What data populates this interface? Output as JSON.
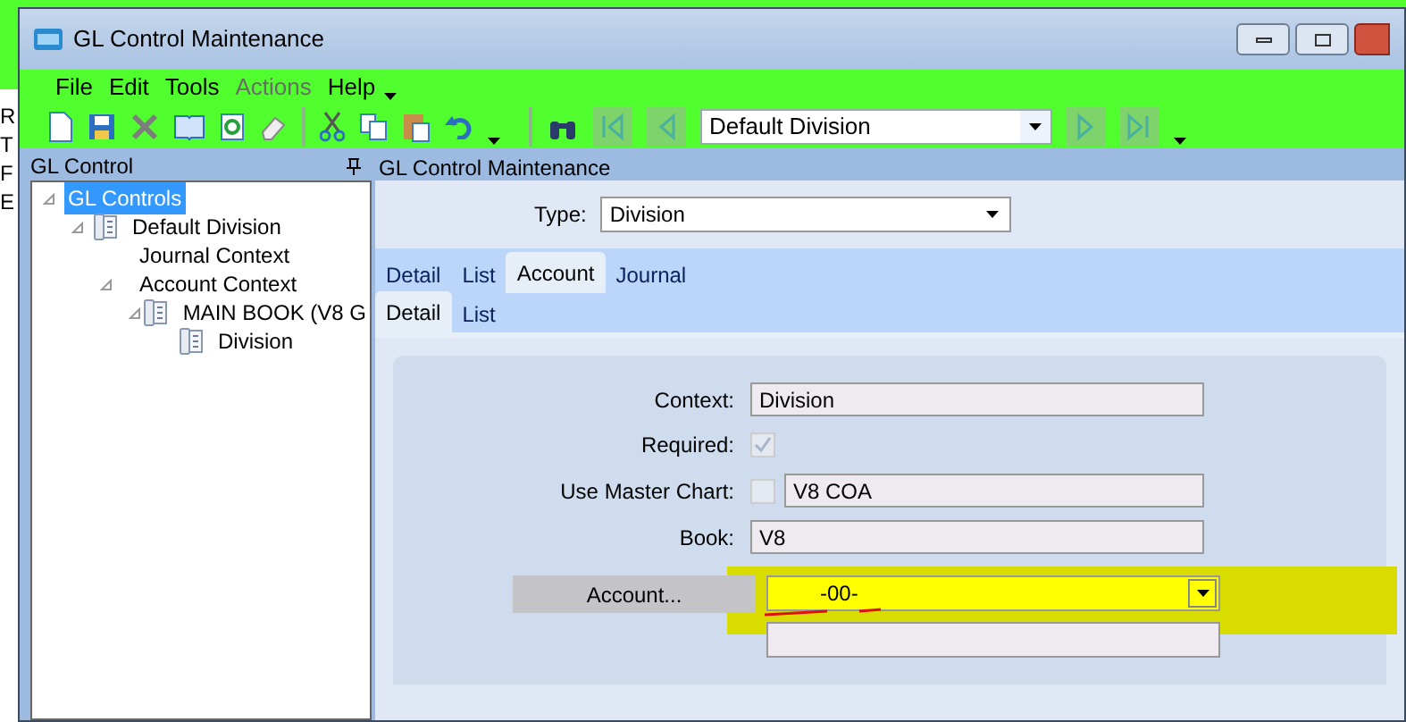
{
  "window": {
    "title": "GL Control Maintenance"
  },
  "background_fragments": [
    "R",
    "T",
    "F",
    "E"
  ],
  "menu": [
    {
      "label": "File",
      "disabled": false
    },
    {
      "label": "Edit",
      "disabled": false
    },
    {
      "label": "Tools",
      "disabled": false
    },
    {
      "label": "Actions",
      "disabled": true
    },
    {
      "label": "Help",
      "disabled": false
    }
  ],
  "toolbar": {
    "division_select": {
      "value": "Default Division"
    }
  },
  "tree_panel": {
    "title": "GL Control",
    "items": [
      {
        "label": "GL Controls",
        "selected": true,
        "expanded": true,
        "icon": false,
        "children": [
          {
            "label": "Default Division",
            "selected": false,
            "expanded": true,
            "icon": true,
            "children": [
              {
                "label": "Journal Context",
                "selected": false,
                "icon": false
              },
              {
                "label": "Account Context",
                "selected": false,
                "expanded": true,
                "icon": false,
                "children": [
                  {
                    "label": "MAIN BOOK (V8 G",
                    "selected": false,
                    "expanded": true,
                    "icon": true,
                    "children": [
                      {
                        "label": "Division",
                        "selected": false,
                        "icon": true
                      }
                    ]
                  }
                ]
              }
            ]
          }
        ]
      }
    ]
  },
  "main_panel": {
    "title": "GL Control Maintenance",
    "type_label": "Type:",
    "type_value": "Division",
    "tabs": [
      {
        "label": "Detail",
        "selected": false
      },
      {
        "label": "List",
        "selected": false
      },
      {
        "label": "Account",
        "selected": true
      },
      {
        "label": "Journal",
        "selected": false
      }
    ],
    "subtabs": [
      {
        "label": "Detail",
        "selected": true
      },
      {
        "label": "List",
        "selected": false
      }
    ],
    "form": {
      "context_label": "Context:",
      "context_value": "Division",
      "required_label": "Required:",
      "required_checked": true,
      "master_label": "Use Master Chart:",
      "master_checked": false,
      "master_value": "V8 COA",
      "book_label": "Book:",
      "book_value": "V8",
      "account_button": "Account...",
      "account_value": "-00-"
    }
  }
}
